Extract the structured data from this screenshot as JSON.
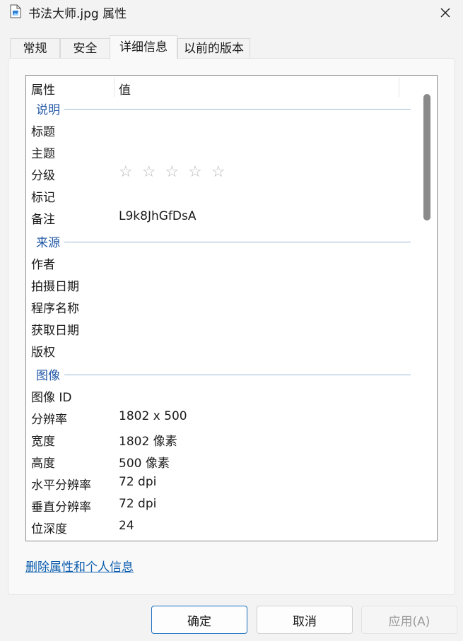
{
  "window": {
    "title": "书法大师.jpg 属性",
    "icon": "image-file-icon"
  },
  "tabs": [
    {
      "label": "常规",
      "active": false
    },
    {
      "label": "安全",
      "active": false
    },
    {
      "label": "详细信息",
      "active": true
    },
    {
      "label": "以前的版本",
      "active": false
    }
  ],
  "columns": {
    "name": "属性",
    "value": "值"
  },
  "groups": {
    "description": {
      "label": "说明",
      "rows": [
        {
          "name": "标题",
          "value": ""
        },
        {
          "name": "主题",
          "value": ""
        },
        {
          "name": "分级",
          "value": "",
          "rating": 0,
          "rating_max": 5
        },
        {
          "name": "标记",
          "value": ""
        },
        {
          "name": "备注",
          "value": "L9k8JhGfDsA"
        }
      ]
    },
    "origin": {
      "label": "来源",
      "rows": [
        {
          "name": "作者",
          "value": ""
        },
        {
          "name": "拍摄日期",
          "value": ""
        },
        {
          "name": "程序名称",
          "value": ""
        },
        {
          "name": "获取日期",
          "value": ""
        },
        {
          "name": "版权",
          "value": ""
        }
      ]
    },
    "image": {
      "label": "图像",
      "rows": [
        {
          "name": "图像 ID",
          "value": ""
        },
        {
          "name": "分辨率",
          "value": "1802 x 500"
        },
        {
          "name": "宽度",
          "value": "1802 像素"
        },
        {
          "name": "高度",
          "value": "500 像素"
        },
        {
          "name": "水平分辨率",
          "value": "72 dpi"
        },
        {
          "name": "垂直分辨率",
          "value": "72 dpi"
        },
        {
          "name": "位深度",
          "value": "24"
        }
      ]
    }
  },
  "stars_glyph": "☆ ☆ ☆ ☆ ☆",
  "remove_link": "删除属性和个人信息",
  "buttons": {
    "ok": "确定",
    "cancel": "取消",
    "apply": "应用(A)"
  },
  "colors": {
    "group_label": "#1f56a7",
    "link": "#0b5cad",
    "accent": "#1a6fc2"
  }
}
